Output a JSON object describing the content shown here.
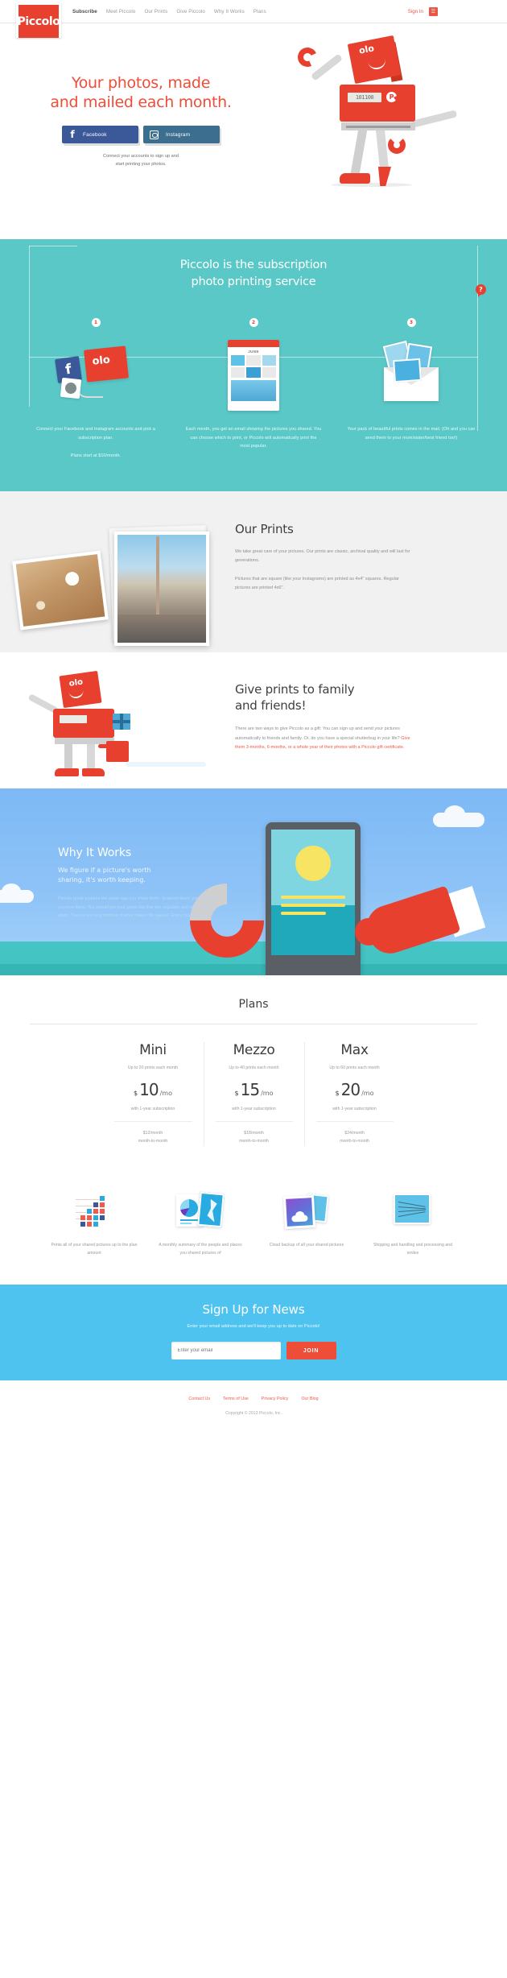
{
  "nav": {
    "logo": "Piccolo",
    "links": [
      {
        "label": "Subscribe",
        "active": true
      },
      {
        "label": "Meet Piccolo",
        "active": false
      },
      {
        "label": "Our Prints",
        "active": false
      },
      {
        "label": "Give Piccolo",
        "active": false
      },
      {
        "label": "Why It Works",
        "active": false
      },
      {
        "label": "Plans",
        "active": false
      }
    ],
    "sign_in": "Sign In",
    "cart_icon": "cart-icon",
    "cart_glyph": "☰"
  },
  "hero": {
    "headline_line1": "Your photos, made",
    "headline_line2": "and mailed each month.",
    "facebook_label": "Facebook",
    "facebook_glyph": "f",
    "instagram_label": "Instagram",
    "note_line1": "Connect your accounts to sign up and",
    "note_line2": "start printing your photos.",
    "robot_display": "101100",
    "robot_badge": "P",
    "robot_label": "olo",
    "accent_red": "#ee4d38",
    "facebook_blue": "#3b5998",
    "instagram_blue": "#3c6e8f"
  },
  "subscription": {
    "title_line1": "Piccolo is the subscription",
    "title_line2": "photo printing service",
    "help_badge": "?",
    "bg_color": "#5bc8c8",
    "steps": [
      {
        "num": "1",
        "text": "Connect your Facebook and Instagram accounts and pick a subscription plan.",
        "sub": "Plans start at $10/month.",
        "art": "social-accounts-icon"
      },
      {
        "num": "2",
        "text": "Each month, you get an email showing the pictures you shared. You can choose which to print, or Piccolo will automatically print the most popular.",
        "sub": "",
        "art": "email-calendar-icon",
        "calendar_month": "JUNE"
      },
      {
        "num": "3",
        "text": "Your pack of beautiful prints comes in the mail. (Oh and you can send them to your mom/sister/best friend too!)",
        "sub": "",
        "art": "envelope-photos-icon"
      }
    ]
  },
  "prints": {
    "title": "Our Prints",
    "paragraph1": "We take great care of your pictures. Our prints are classic, archival quality and will last for generations.",
    "paragraph2": "Pictures that are square (like your Instagrams) are printed as 4x4\" squares. Regular pictures are printed 4x6\".",
    "bg_color": "#f1f1f1"
  },
  "give": {
    "title_line1": "Give prints to family",
    "title_line2": "and friends!",
    "paragraph_plain": "There are two ways to give Piccolo as a gift: You can sign up and send your pictures automatically to friends and family. Or, do you have a special shutterbug in your life? ",
    "paragraph_highlight": "Give them 3-months, 6-months, or a whole year of their photos with a Piccolo gift certificate."
  },
  "why": {
    "title": "Why It Works",
    "subtitle_line1": "We figure if a picture's worth",
    "subtitle_line2": "sharing, it's worth keeping.",
    "body": "Piccolo prints pictures the same way you share them. Snap'em them, you tag them, you love them. You should get your prints like that too, regularly and without extra steps. They're are long timeline of what makes life special. Every month. Easy."
  },
  "plans": {
    "title": "Plans",
    "items": [
      {
        "name": "Mini",
        "limit": "Up to 20 prints each month",
        "currency": "$",
        "amount": "10",
        "per": "/mo",
        "terms": "with 1-year subscription",
        "alt_price": "$12/month",
        "alt_terms": "month-to-month"
      },
      {
        "name": "Mezzo",
        "limit": "Up to 40 prints each month",
        "currency": "$",
        "amount": "15",
        "per": "/mo",
        "terms": "with 1-year subscription",
        "alt_price": "$18/month",
        "alt_terms": "month-to-month"
      },
      {
        "name": "Max",
        "limit": "Up to 60 prints each month",
        "currency": "$",
        "amount": "20",
        "per": "/mo",
        "terms": "with 1-year subscription",
        "alt_price": "$24/month",
        "alt_terms": "month-to-month"
      }
    ]
  },
  "features": [
    {
      "icon": "print-grid-icon",
      "text": "Prints all of your shared pictures up to the plan amount"
    },
    {
      "icon": "chart-map-icon",
      "text": "A monthly summary of the people and places you shared pictures of"
    },
    {
      "icon": "cloud-photo-icon",
      "text": "Cloud backup of all your shared pictures"
    },
    {
      "icon": "mail-envelope-icon",
      "text": "Shipping and handling and processing and smiles"
    }
  ],
  "signup": {
    "title": "Sign Up for News",
    "subtitle": "Enter your email address and we'll keep you up to date on Piccolo!",
    "placeholder": "Enter your email",
    "button": "JOIN",
    "bg_color": "#4ec3f0"
  },
  "footer": {
    "links": [
      "Contact Us",
      "Terms of Use",
      "Privacy Policy",
      "Our Blog"
    ],
    "copyright": "Copyright © 2013 Piccolo, Inc."
  }
}
